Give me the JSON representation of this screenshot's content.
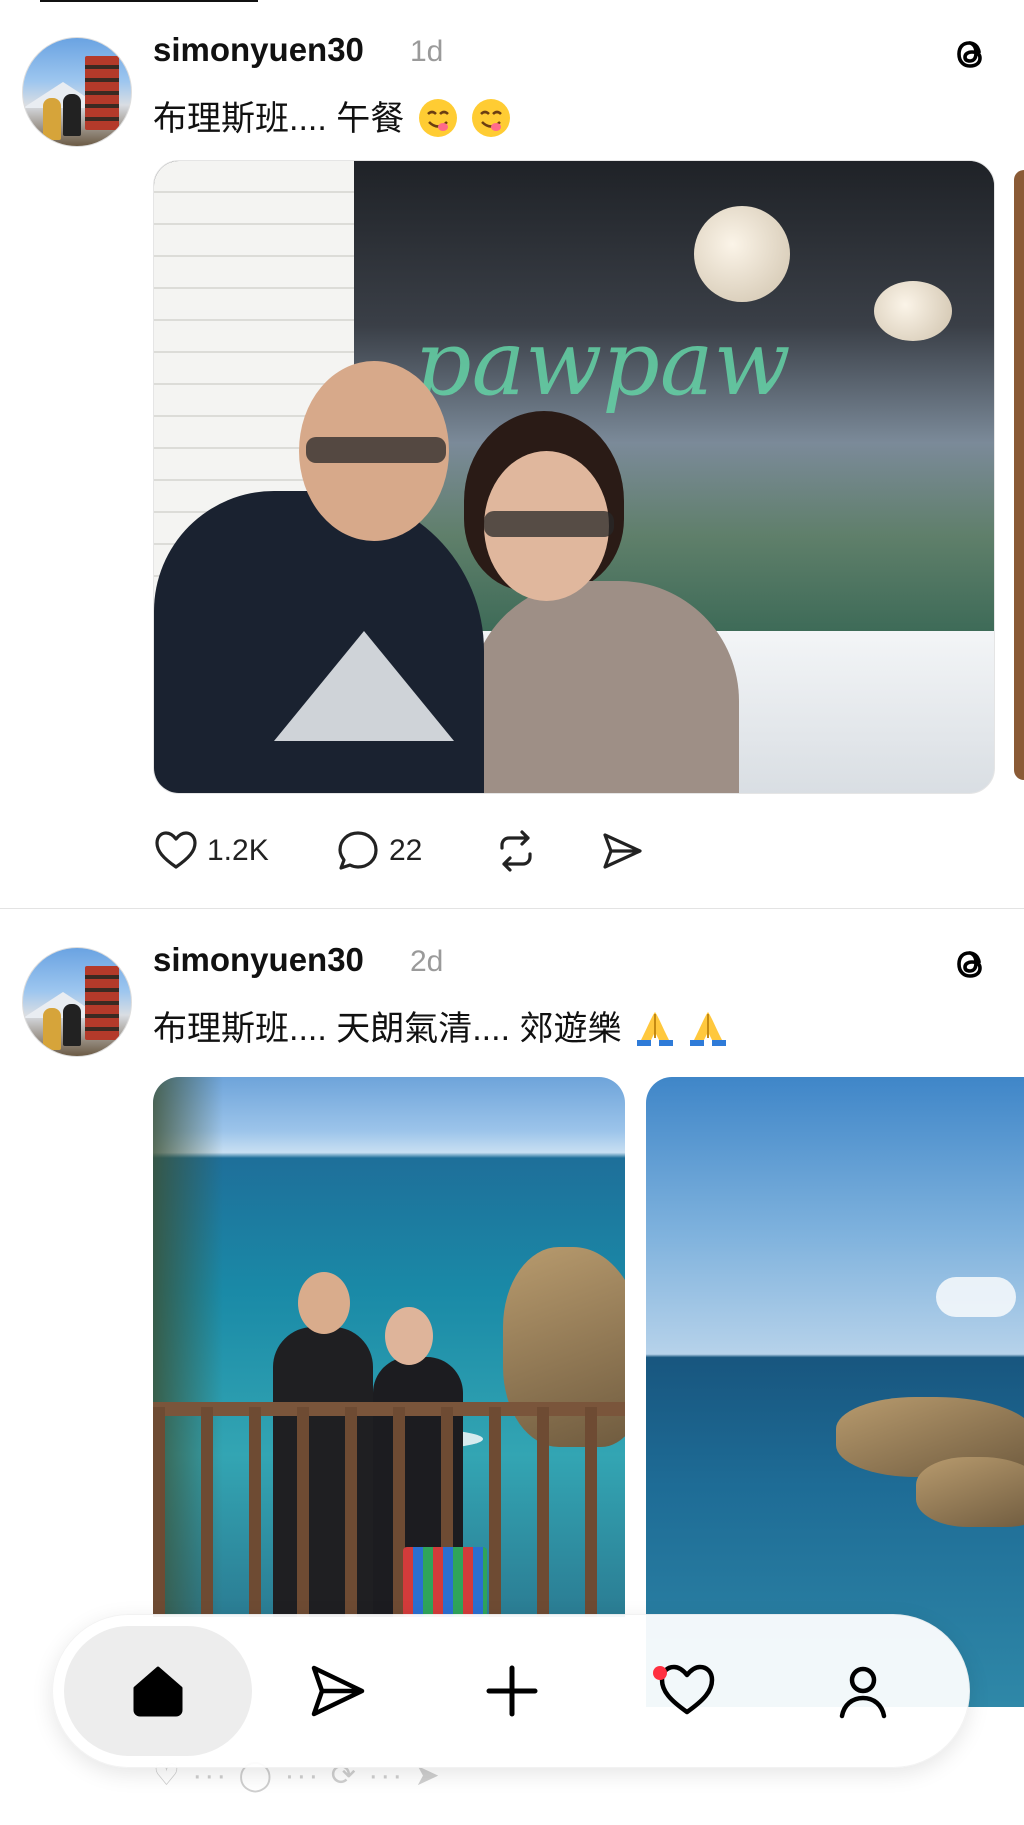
{
  "posts": [
    {
      "username": "simonyuen30",
      "time": "1d",
      "caption": "布理斯班.... 午餐",
      "caption_emojis": [
        "yum-emoji",
        "yum-emoji"
      ],
      "neon_text": "pawpaw",
      "actions": {
        "likes": "1.2K",
        "comments": "22"
      }
    },
    {
      "username": "simonyuen30",
      "time": "2d",
      "caption": "布理斯班.... 天朗氣清.... 郊遊樂",
      "caption_emojis": [
        "folded-hands-emoji",
        "folded-hands-emoji"
      ]
    }
  ],
  "nav": {
    "items": [
      "home-icon",
      "send-icon",
      "plus-icon",
      "heart-icon",
      "profile-icon"
    ],
    "active": "home-icon",
    "activity_has_notification": true
  },
  "colors": {
    "accent": "#000000",
    "notification": "#ff3040",
    "muted_text": "#9a9a9a"
  }
}
